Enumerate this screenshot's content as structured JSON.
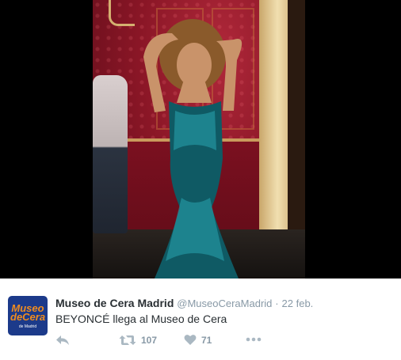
{
  "tweet": {
    "display_name": "Museo de Cera Madrid",
    "handle": "@MuseoCeraMadrid",
    "separator": "·",
    "time": "22 feb.",
    "text": "BEYONCÉ llega al Museo de Cera",
    "avatar_logo_line1": "Museo",
    "avatar_logo_line2": "deCera",
    "avatar_logo_sub": "de Madrid",
    "actions": {
      "reply_icon": "reply-icon",
      "retweet_icon": "retweet-icon",
      "retweet_count": "107",
      "like_icon": "heart-icon",
      "like_count": "71",
      "more_icon": "more-dots-icon"
    }
  },
  "colors": {
    "name_text": "#292f33",
    "meta_text": "#8899a6",
    "icon": "#aab8c2",
    "avatar_bg": "#1c3a8a",
    "avatar_logo": "#f08c1e"
  }
}
